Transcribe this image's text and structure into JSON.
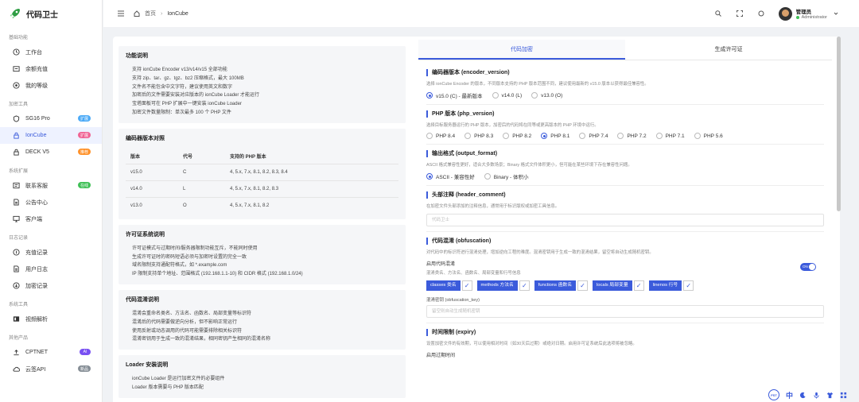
{
  "app": {
    "name": "代码卫士"
  },
  "sidebar": {
    "sections": [
      {
        "title": "基础功能",
        "items": [
          {
            "label": "工作台"
          },
          {
            "label": "余额充值"
          },
          {
            "label": "我的等级"
          }
        ]
      },
      {
        "title": "加密工具",
        "items": [
          {
            "label": "SG16 Pro",
            "badge": "扩展"
          },
          {
            "label": "IonCube",
            "badge": "扩展"
          },
          {
            "label": "DECK V5",
            "badge": "推荐"
          }
        ]
      },
      {
        "title": "系统扩展",
        "items": [
          {
            "label": "联系客服",
            "badge": "在线"
          },
          {
            "label": "公告中心"
          },
          {
            "label": "客户端"
          }
        ]
      },
      {
        "title": "日志记录",
        "items": [
          {
            "label": "充值记录"
          },
          {
            "label": "用户日志"
          },
          {
            "label": "加密记录"
          }
        ]
      },
      {
        "title": "系统工具",
        "items": [
          {
            "label": "视频解析"
          }
        ]
      },
      {
        "title": "其他产品",
        "items": [
          {
            "label": "CPTNET",
            "badge": "AI"
          },
          {
            "label": "云签API",
            "badge": "新品"
          }
        ]
      }
    ]
  },
  "topbar": {
    "home": "首页",
    "current": "IonCube",
    "user_name": "管理员",
    "user_role": "Administrator"
  },
  "left": {
    "features": {
      "title": "功能说明",
      "lines": [
        "支持 ionCube Encoder v13/v14/v15 全部功能",
        "支持 zip、tar、gz、tgz、bz2 压缩格式，最大 100MB",
        "文件名不能包含中文字符，建议使用英文和数字",
        "加密后的文件需要安装对应版本的 ionCube Loader 才能运行",
        "宝塔面板可在 PHP 扩展中一键安装 ionCube Loader",
        "加密文件数量限制：单次最多 100 个 PHP 文件"
      ]
    },
    "versions": {
      "title": "编码器版本对照",
      "headers": [
        "版本",
        "代号",
        "支持的 PHP 版本"
      ],
      "rows": [
        [
          "v15.0",
          "C",
          "4, 5.x, 7.x, 8.1, 8.2, 8.3, 8.4"
        ],
        [
          "v14.0",
          "L",
          "4, 5.x, 7.x, 8.1, 8.2, 8.3"
        ],
        [
          "v13.0",
          "O",
          "4, 5.x, 7.x, 8.1, 8.2"
        ]
      ]
    },
    "license": {
      "title": "许可证系统说明",
      "lines": [
        "许可证模式与过期时间/服务器限制功能互斥，不能同时使用",
        "生成许可证时的密码短语必须与加密时设置的完全一致",
        "域名限制支持通配符格式，如 *.example.com",
        "IP 限制支持单个地址、范围格式 (192.168.1.1-10) 和 CIDR 格式 (192.168.1.0/24)"
      ]
    },
    "obf": {
      "title": "代码混淆说明",
      "lines": [
        "混淆会重命名类名、方法名、函数名、局部变量等标识符",
        "混淆后的代码需要做逆向分析，但不影响正常运行",
        "使用反射或动态调用的代码可能需要排除相关标识符",
        "混淆密钥用于生成一致的混淆结果，相同密钥产生相同的混淆名称"
      ]
    },
    "loader": {
      "title": "Loader 安装说明",
      "lines": [
        "ionCube Loader 是运行加密文件的必要组件",
        "Loader 版本需要与 PHP 版本匹配"
      ]
    }
  },
  "right": {
    "tabs": [
      "代码加密",
      "生成许可证"
    ],
    "encoder": {
      "title": "编码器版本 (encoder_version)",
      "desc": "选择 ionCube Encoder 的版本，不同版本支持的 PHP 版本范围不同，建议使用最新的 v15.0 版本以获得最佳兼容性。",
      "options": [
        "v15.0 (C) - 最新版本",
        "v14.0 (L)",
        "v13.0 (O)"
      ]
    },
    "php": {
      "title": "PHP 版本 (php_version)",
      "desc": "选择目标服务器运行的 PHP 版本，加密后的代码将在同等或更高版本的 PHP 环境中运行。",
      "options": [
        "PHP 8.4",
        "PHP 8.3",
        "PHP 8.2",
        "PHP 8.1",
        "PHP 7.4",
        "PHP 7.2",
        "PHP 7.1",
        "PHP 5.6"
      ]
    },
    "output": {
      "title": "输出格式 (output_format)",
      "desc": "ASCII 格式兼容性更好，适合大多数场景；Binary 格式文件体积更小，但可能在某些环境下存在兼容性问题。",
      "options": [
        "ASCII - 兼容性好",
        "Binary - 体积小"
      ]
    },
    "header": {
      "title": "头部注释 (header_comment)",
      "desc": "在加密文件头部添加的注释信息，通常用于标识版权或加密工具信息。",
      "placeholder": "代码卫士"
    },
    "obfuscation": {
      "title": "代码混淆 (obfuscation)",
      "desc": "对代码中的标识符进行混淆处理，增加逆向工程的难度。混淆密钥用于生成一致的混淆结果，留空将自动生成随机密钥。",
      "enable_label": "启用代码混淆",
      "enable_desc": "混淆类名、方法名、函数名、局部变量和行号信息",
      "toggle": "ON",
      "tags": [
        "classes 类名",
        "methods 方法名",
        "functions 函数名",
        "locals 局部变量",
        "linenos 行号"
      ],
      "key_label": "混淆密钥 (obfuscation_key)",
      "key_placeholder": "留空则自动生成随机密钥"
    },
    "expiry": {
      "title": "时间限制 (expiry)",
      "desc": "设置加密文件的有效期，可以使用相对时间（如30天后过期）或绝对日期。启用许可证系统后此选项将被忽略。",
      "enable_label": "启用过期时间"
    }
  },
  "float_toolbar": {
    "brand": "FST",
    "lang": "中"
  },
  "colors": {
    "accent": "#3b5bdb",
    "badge_blue": "#4dabf7",
    "badge_pink": "#f06595",
    "badge_orange": "#ff922b",
    "badge_green": "#40c057",
    "badge_purple": "#7950f2",
    "badge_gray": "#868e96"
  }
}
